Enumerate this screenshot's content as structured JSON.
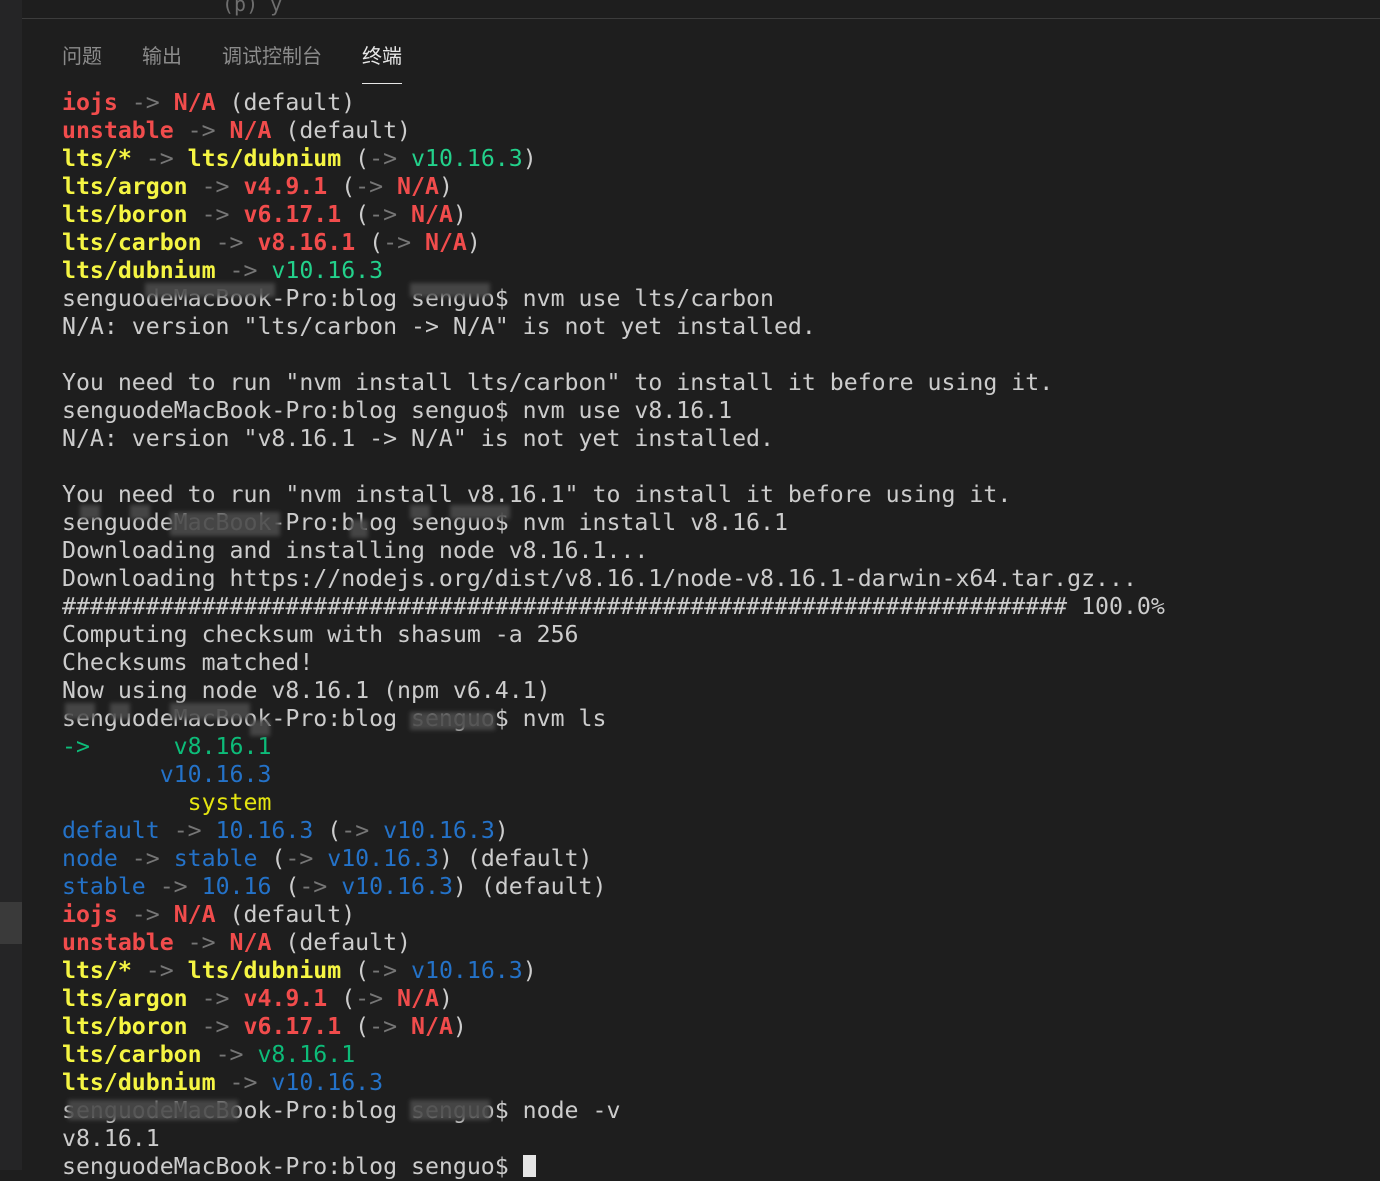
{
  "top_strip": {
    "text": "(p) y"
  },
  "tabs": [
    {
      "label": "问题",
      "active": false
    },
    {
      "label": "输出",
      "active": false
    },
    {
      "label": "调试控制台",
      "active": false
    },
    {
      "label": "终端",
      "active": true
    }
  ],
  "terminal": {
    "lines": [
      [
        [
          "iojs",
          "c-red"
        ],
        [
          " -> ",
          "c-gray"
        ],
        [
          "N/A",
          "c-red"
        ],
        [
          " (default)",
          "c-white"
        ]
      ],
      [
        [
          "unstable",
          "c-red"
        ],
        [
          " -> ",
          "c-gray"
        ],
        [
          "N/A",
          "c-red"
        ],
        [
          " (default)",
          "c-white"
        ]
      ],
      [
        [
          "lts/*",
          "c-yellow"
        ],
        [
          " -> ",
          "c-gray"
        ],
        [
          "lts/dubnium",
          "c-yellow"
        ],
        [
          " (",
          "c-white"
        ],
        [
          "->",
          "c-gray"
        ],
        [
          " v10.16.3",
          "c-green"
        ],
        [
          ")",
          "c-white"
        ]
      ],
      [
        [
          "lts/argon",
          "c-yellow"
        ],
        [
          " -> ",
          "c-gray"
        ],
        [
          "v4.9.1",
          "c-red"
        ],
        [
          " (",
          "c-white"
        ],
        [
          "->",
          "c-gray"
        ],
        [
          " N/A",
          "c-red"
        ],
        [
          ")",
          "c-white"
        ]
      ],
      [
        [
          "lts/boron",
          "c-yellow"
        ],
        [
          " -> ",
          "c-gray"
        ],
        [
          "v6.17.1",
          "c-red"
        ],
        [
          " (",
          "c-white"
        ],
        [
          "->",
          "c-gray"
        ],
        [
          " N/A",
          "c-red"
        ],
        [
          ")",
          "c-white"
        ]
      ],
      [
        [
          "lts/carbon",
          "c-yellow"
        ],
        [
          " -> ",
          "c-gray"
        ],
        [
          "v8.16.1",
          "c-red"
        ],
        [
          " (",
          "c-white"
        ],
        [
          "->",
          "c-gray"
        ],
        [
          " N/A",
          "c-red"
        ],
        [
          ")",
          "c-white"
        ]
      ],
      [
        [
          "lts/dubnium",
          "c-yellow"
        ],
        [
          " -> ",
          "c-gray"
        ],
        [
          "v10.16.3",
          "c-green"
        ]
      ],
      [
        [
          "senguodeMacBook-Pro:blog senguo$ nvm use lts/carbon",
          "c-white"
        ]
      ],
      [
        [
          "N/A: version \"lts/carbon -> N/A\" is not yet installed.",
          "c-white"
        ]
      ],
      [
        [
          "",
          "c-white"
        ]
      ],
      [
        [
          "You need to run \"nvm install lts/carbon\" to install it before using it.",
          "c-white"
        ]
      ],
      [
        [
          "senguodeMacBook-Pro:blog senguo$ nvm use v8.16.1",
          "c-white"
        ]
      ],
      [
        [
          "N/A: version \"v8.16.1 -> N/A\" is not yet installed.",
          "c-white"
        ]
      ],
      [
        [
          "",
          "c-white"
        ]
      ],
      [
        [
          "You need to run \"nvm install v8.16.1\" to install it before using it.",
          "c-white"
        ]
      ],
      [
        [
          "senguodeMacBook-Pro:blog senguo$ nvm install v8.16.1",
          "c-white"
        ]
      ],
      [
        [
          "Downloading and installing node v8.16.1...",
          "c-white"
        ]
      ],
      [
        [
          "Downloading https://nodejs.org/dist/v8.16.1/node-v8.16.1-darwin-x64.tar.gz...",
          "c-white"
        ]
      ],
      [
        [
          "######################################################################## 100.0%",
          "c-white"
        ]
      ],
      [
        [
          "Computing checksum with shasum -a 256",
          "c-white"
        ]
      ],
      [
        [
          "Checksums matched!",
          "c-white"
        ]
      ],
      [
        [
          "Now using node v8.16.1 (npm v6.4.1)",
          "c-white"
        ]
      ],
      [
        [
          "senguodeMacBook-Pro:blog senguo$ nvm ls",
          "c-white"
        ]
      ],
      [
        [
          "->",
          "c-green2"
        ],
        [
          "      v8.16.1",
          "c-green2"
        ]
      ],
      [
        [
          "       v10.16.3",
          "c-blue"
        ]
      ],
      [
        [
          "         system",
          "c-yellow-n"
        ]
      ],
      [
        [
          "default",
          "c-blue"
        ],
        [
          " -> ",
          "c-gray"
        ],
        [
          "10.16.3",
          "c-blue"
        ],
        [
          " (",
          "c-white"
        ],
        [
          "->",
          "c-gray"
        ],
        [
          " v10.16.3",
          "c-blue"
        ],
        [
          ")",
          "c-white"
        ]
      ],
      [
        [
          "node",
          "c-blue"
        ],
        [
          " -> ",
          "c-gray"
        ],
        [
          "stable",
          "c-blue"
        ],
        [
          " (",
          "c-white"
        ],
        [
          "->",
          "c-gray"
        ],
        [
          " v10.16.3",
          "c-blue"
        ],
        [
          ") (default)",
          "c-white"
        ]
      ],
      [
        [
          "stable",
          "c-blue"
        ],
        [
          " -> ",
          "c-gray"
        ],
        [
          "10.16",
          "c-blue"
        ],
        [
          " (",
          "c-white"
        ],
        [
          "->",
          "c-gray"
        ],
        [
          " v10.16.3",
          "c-blue"
        ],
        [
          ") (default)",
          "c-white"
        ]
      ],
      [
        [
          "iojs",
          "c-red"
        ],
        [
          " -> ",
          "c-gray"
        ],
        [
          "N/A",
          "c-red"
        ],
        [
          " (default)",
          "c-white"
        ]
      ],
      [
        [
          "unstable",
          "c-red"
        ],
        [
          " -> ",
          "c-gray"
        ],
        [
          "N/A",
          "c-red"
        ],
        [
          " (default)",
          "c-white"
        ]
      ],
      [
        [
          "lts/*",
          "c-yellow"
        ],
        [
          " -> ",
          "c-gray"
        ],
        [
          "lts/dubnium",
          "c-yellow"
        ],
        [
          " (",
          "c-white"
        ],
        [
          "->",
          "c-gray"
        ],
        [
          " v10.16.3",
          "c-blue"
        ],
        [
          ")",
          "c-white"
        ]
      ],
      [
        [
          "lts/argon",
          "c-yellow"
        ],
        [
          " -> ",
          "c-gray"
        ],
        [
          "v4.9.1",
          "c-red"
        ],
        [
          " (",
          "c-white"
        ],
        [
          "->",
          "c-gray"
        ],
        [
          " N/A",
          "c-red"
        ],
        [
          ")",
          "c-white"
        ]
      ],
      [
        [
          "lts/boron",
          "c-yellow"
        ],
        [
          " -> ",
          "c-gray"
        ],
        [
          "v6.17.1",
          "c-red"
        ],
        [
          " (",
          "c-white"
        ],
        [
          "->",
          "c-gray"
        ],
        [
          " N/A",
          "c-red"
        ],
        [
          ")",
          "c-white"
        ]
      ],
      [
        [
          "lts/carbon",
          "c-yellow"
        ],
        [
          " -> ",
          "c-gray"
        ],
        [
          "v8.16.1",
          "c-green2"
        ]
      ],
      [
        [
          "lts/dubnium",
          "c-yellow"
        ],
        [
          " -> ",
          "c-gray"
        ],
        [
          "v10.16.3",
          "c-blue"
        ]
      ],
      [
        [
          "senguodeMacBook-Pro:blog senguo$ node -v",
          "c-white"
        ]
      ],
      [
        [
          "v8.16.1",
          "c-white"
        ]
      ],
      [
        [
          "senguodeMacBook-Pro:blog senguo$ ",
          "c-white"
        ]
      ]
    ]
  },
  "colors": {
    "background": "#1e1e1e",
    "red": "#f14c4c",
    "yellow": "#f5f543",
    "green": "#23d18b",
    "blue": "#2472c8"
  }
}
